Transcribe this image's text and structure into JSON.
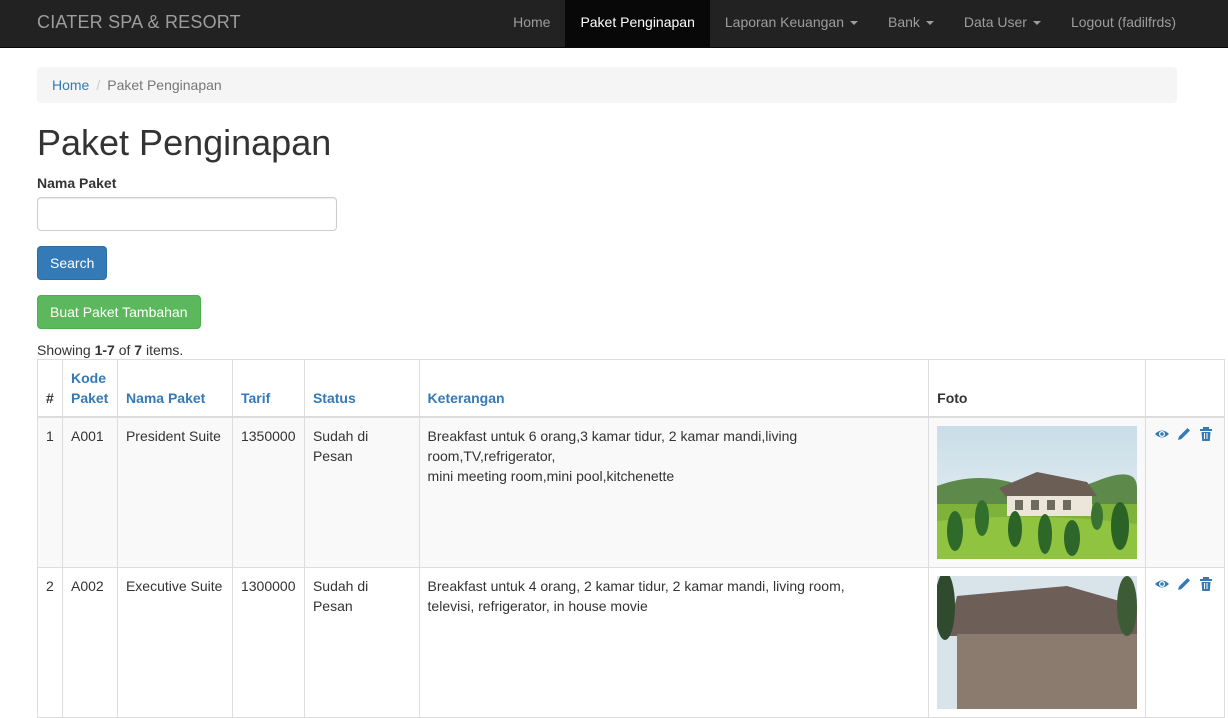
{
  "brand": "CIATER SPA & RESORT",
  "nav": [
    {
      "label": "Home",
      "active": false,
      "dropdown": false
    },
    {
      "label": "Paket Penginapan",
      "active": true,
      "dropdown": false
    },
    {
      "label": "Laporan Keuangan",
      "active": false,
      "dropdown": true
    },
    {
      "label": "Bank",
      "active": false,
      "dropdown": true
    },
    {
      "label": "Data User",
      "active": false,
      "dropdown": true
    },
    {
      "label": "Logout (fadilfrds)",
      "active": false,
      "dropdown": false
    }
  ],
  "breadcrumb": {
    "home": "Home",
    "current": "Paket Penginapan"
  },
  "page_title": "Paket Penginapan",
  "search": {
    "label": "Nama Paket",
    "value": "",
    "placeholder": "",
    "button": "Search"
  },
  "create_button": "Buat Paket Tambahan",
  "summary": {
    "prefix": "Showing ",
    "range": "1-7",
    "of": " of ",
    "total": "7",
    "suffix": " items."
  },
  "table": {
    "headers": {
      "num": "#",
      "kode_1": "Kode",
      "kode_2": "Paket",
      "nama": "Nama Paket",
      "tarif": "Tarif",
      "status": "Status",
      "keterangan": "Keterangan",
      "foto": "Foto"
    },
    "rows": [
      {
        "num": "1",
        "kode": "A001",
        "nama": "President Suite",
        "tarif": "1350000",
        "status": "Sudah di Pesan",
        "ket_1": "Breakfast untuk 6 orang,3 kamar tidur, 2 kamar mandi,living room,TV,refrigerator,",
        "ket_2": "mini meeting room,mini pool,kitchenette"
      },
      {
        "num": "2",
        "kode": "A002",
        "nama": "Executive Suite",
        "tarif": "1300000",
        "status": "Sudah di Pesan",
        "ket_1": "Breakfast untuk 4 orang, 2 kamar tidur, 2 kamar mandi, living room,",
        "ket_2": "televisi, refrigerator, in house movie"
      }
    ]
  },
  "icons": {
    "view": "eye-icon",
    "edit": "pencil-icon",
    "delete": "trash-icon"
  },
  "colors": {
    "navbar": "#222222",
    "link": "#337ab7",
    "primary": "#337ab7",
    "success": "#5cb85c"
  }
}
